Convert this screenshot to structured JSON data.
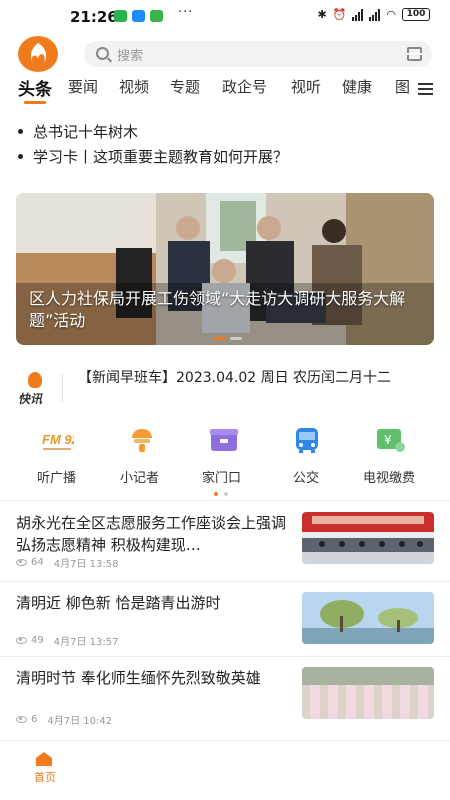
{
  "status_bar": {
    "time": "21:26",
    "more": "···",
    "battery": "100"
  },
  "search": {
    "placeholder": "搜索"
  },
  "tabs": [
    "头条",
    "要闻",
    "视频",
    "专题",
    "政企号",
    "视听",
    "健康",
    "图"
  ],
  "active_tab": "头条",
  "headlines": [
    "总书记十年树木",
    "学习卡丨这项重要主题教育如何开展？"
  ],
  "banner": {
    "caption": "区人力社保局开展工伤领域“大走访大调研大服务大解题”活动"
  },
  "kuaixun": {
    "label": "快讯",
    "text": "【新闻早班车】2023.04.02 周日 农历闰二月十二"
  },
  "shortcuts": [
    {
      "label": "听广播",
      "icon": "radio-icon"
    },
    {
      "label": "小记者",
      "icon": "reporter-icon"
    },
    {
      "label": "家门口",
      "icon": "community-icon"
    },
    {
      "label": "公交",
      "icon": "bus-icon"
    },
    {
      "label": "电视缴费",
      "icon": "tv-payment-icon"
    }
  ],
  "radio_logo_text": "FM 92.6",
  "news": [
    {
      "title": "胡永光在全区志愿服务工作座谈会上强调 弘扬志愿精神 积极构建现…",
      "views": "64",
      "time": "4月7日 13:58"
    },
    {
      "title": "清明近 柳色新 恰是踏青出游时",
      "views": "49",
      "time": "4月7日 13:57"
    },
    {
      "title": "清明时节 奉化师生缅怀先烈致敬英雄",
      "views": "6",
      "time": "4月7日 10:42"
    }
  ],
  "bottom_nav": {
    "home": "首页"
  },
  "colors": {
    "accent": "#f07b1d"
  }
}
